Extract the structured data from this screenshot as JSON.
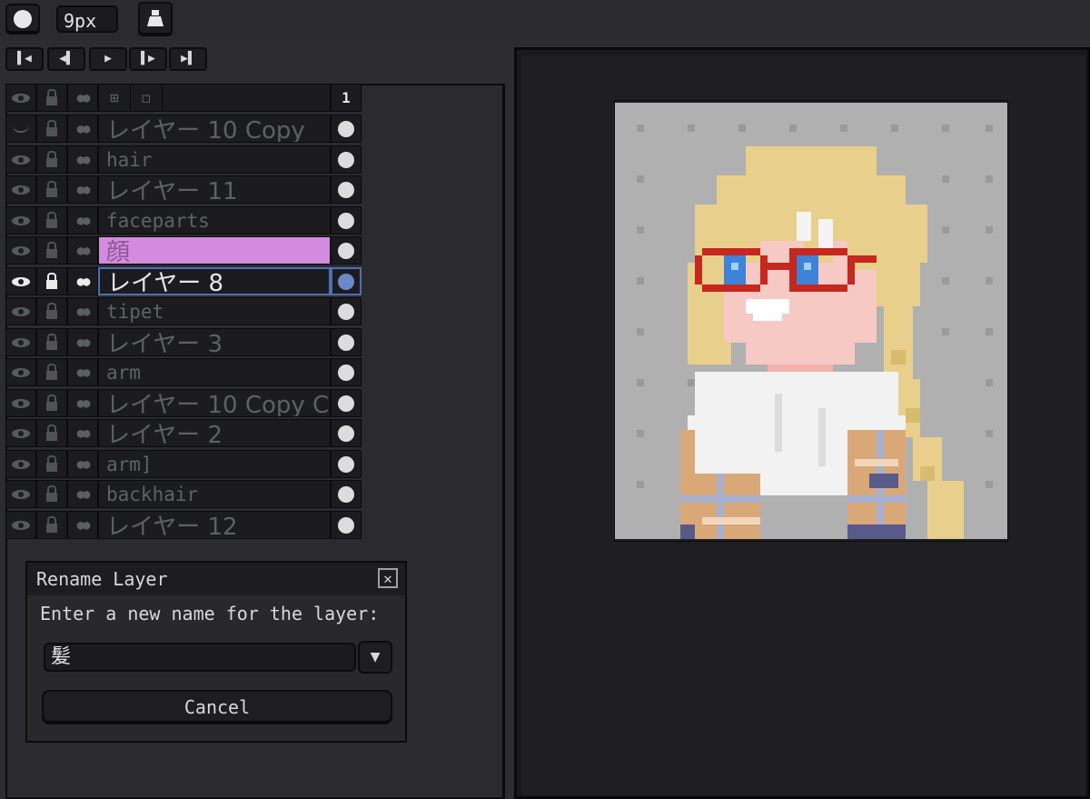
{
  "toolbar": {
    "brush_icon": "circle-icon",
    "brush_size": "9px",
    "bucket_icon": "bucket-icon"
  },
  "playback": {
    "buttons": [
      {
        "icon": "first-frame-icon",
        "glyph": "⏮"
      },
      {
        "icon": "prev-frame-icon",
        "glyph": "◀"
      },
      {
        "icon": "play-icon",
        "glyph": "▶"
      },
      {
        "icon": "next-frame-icon",
        "glyph": "▶"
      },
      {
        "icon": "last-frame-icon",
        "glyph": "⏭"
      }
    ]
  },
  "layers": {
    "frame_number": "1",
    "items": [
      {
        "name": "レイヤー 10 Copy",
        "visible": false
      },
      {
        "name": "hair",
        "visible": true
      },
      {
        "name": "レイヤー 11",
        "visible": true
      },
      {
        "name": "faceparts",
        "visible": true
      },
      {
        "name": "顔",
        "visible": true,
        "color": "#d38be0"
      },
      {
        "name": "レイヤー 8",
        "visible": true,
        "selected": true
      },
      {
        "name": "tipet",
        "visible": true
      },
      {
        "name": "レイヤー 3",
        "visible": true
      },
      {
        "name": "arm",
        "visible": true
      },
      {
        "name": "レイヤー 10 Copy C",
        "visible": true
      },
      {
        "name": "レイヤー 2",
        "visible": true
      },
      {
        "name": "arm]",
        "visible": true
      },
      {
        "name": "backhair",
        "visible": true
      },
      {
        "name": "レイヤー 12",
        "visible": true
      }
    ]
  },
  "dialog": {
    "title": "Rename Layer",
    "prompt": "Enter a new name for the layer:",
    "input_value": "髪",
    "cancel_label": "Cancel",
    "close_glyph": "✕"
  },
  "colors": {
    "accent": "#4d6fb6",
    "pink_layer": "#d38be0",
    "canvas_bg": "#b0b0b0"
  }
}
